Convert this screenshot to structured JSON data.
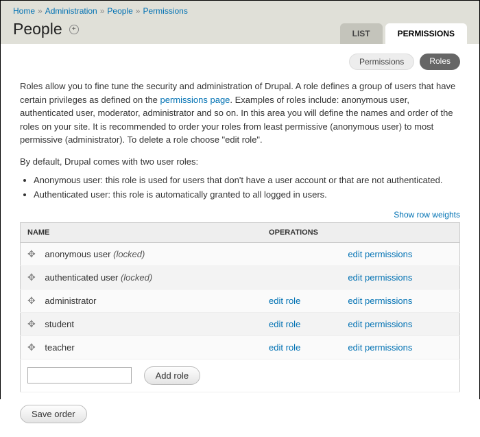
{
  "breadcrumb": {
    "home": "Home",
    "admin": "Administration",
    "people": "People",
    "perms": "Permissions"
  },
  "page_title": "People",
  "tabs": {
    "list": "List",
    "permissions": "Permissions"
  },
  "sub_tabs": {
    "permissions": "Permissions",
    "roles": "Roles"
  },
  "intro_pre": "Roles allow you to fine tune the security and administration of Drupal. A role defines a group of users that have certain privileges as defined on the ",
  "intro_link": "permissions page",
  "intro_post": ". Examples of roles include: anonymous user, authenticated user, moderator, administrator and so on. In this area you will define the names and order of the roles on your site. It is recommended to order your roles from least permissive (anonymous user) to most permissive (administrator). To delete a role choose \"edit role\".",
  "default_intro": "By default, Drupal comes with two user roles:",
  "bullets": {
    "anon": "Anonymous user: this role is used for users that don't have a user account or that are not authenticated.",
    "auth": "Authenticated user: this role is automatically granted to all logged in users."
  },
  "show_weights": "Show row weights",
  "table": {
    "col_name": "NAME",
    "col_ops": "OPERATIONS",
    "rows": [
      {
        "name": "anonymous user",
        "locked": "(locked)",
        "edit_role": "",
        "edit_perm": "edit permissions"
      },
      {
        "name": "authenticated user",
        "locked": "(locked)",
        "edit_role": "",
        "edit_perm": "edit permissions"
      },
      {
        "name": "administrator",
        "locked": "",
        "edit_role": "edit role",
        "edit_perm": "edit permissions"
      },
      {
        "name": "student",
        "locked": "",
        "edit_role": "edit role",
        "edit_perm": "edit permissions"
      },
      {
        "name": "teacher",
        "locked": "",
        "edit_role": "edit role",
        "edit_perm": "edit permissions"
      }
    ]
  },
  "add_role_btn": "Add role",
  "save_order_btn": "Save order"
}
